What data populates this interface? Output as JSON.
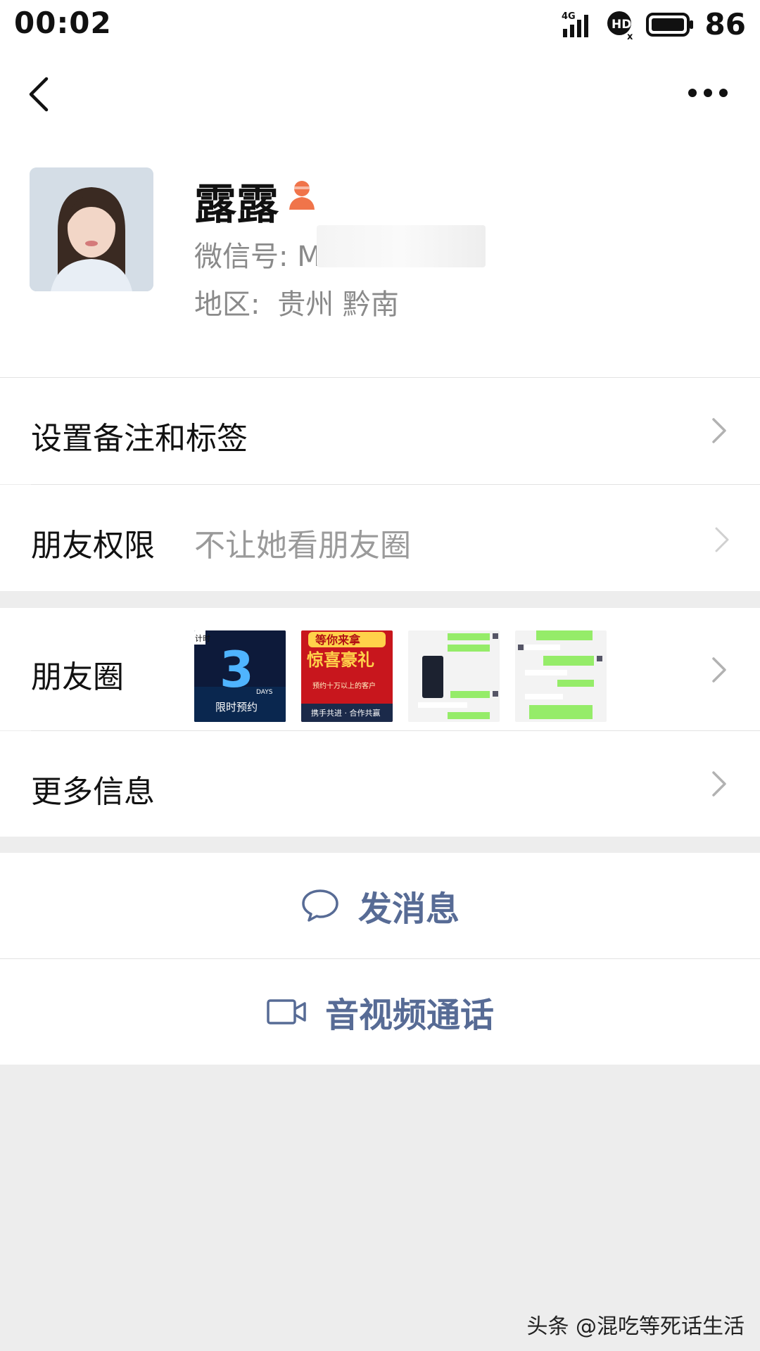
{
  "status_bar": {
    "time": "00:02",
    "network": "4G",
    "hd_label": "HD",
    "battery": "86"
  },
  "nav": {
    "back_icon": "chevron-left-icon",
    "more_icon": "more-dots-icon"
  },
  "profile": {
    "name": "露露",
    "gender_icon": "female-icon",
    "wechat_id_label": "微信号: M",
    "region_label": "地区:",
    "region_value": "贵州  黔南"
  },
  "rows": {
    "remark": {
      "label": "设置备注和标签"
    },
    "permission": {
      "label": "朋友权限",
      "value": "不让她看朋友圈"
    },
    "moments": {
      "label": "朋友圈",
      "thumbs": [
        {
          "badge": "计时",
          "big": "3",
          "days": "DAYS",
          "caption": "限时预约"
        },
        {
          "title1": "等你来拿",
          "title2": "惊喜豪礼",
          "line1": "预约十万以上的客户",
          "line2": "携手共进 · 合作共赢"
        },
        {
          "kind": "chat-screenshot"
        },
        {
          "kind": "chat-screenshot"
        }
      ]
    },
    "more_info": {
      "label": "更多信息"
    }
  },
  "actions": {
    "message": {
      "label": "发消息",
      "icon": "chat-bubble-icon"
    },
    "call": {
      "label": "音视频通话",
      "icon": "video-camera-icon"
    }
  },
  "watermark": "头条 @混吃等死话生活",
  "colors": {
    "link_blue": "#576b95",
    "background": "#ededed",
    "female_orange": "#f0744a"
  }
}
